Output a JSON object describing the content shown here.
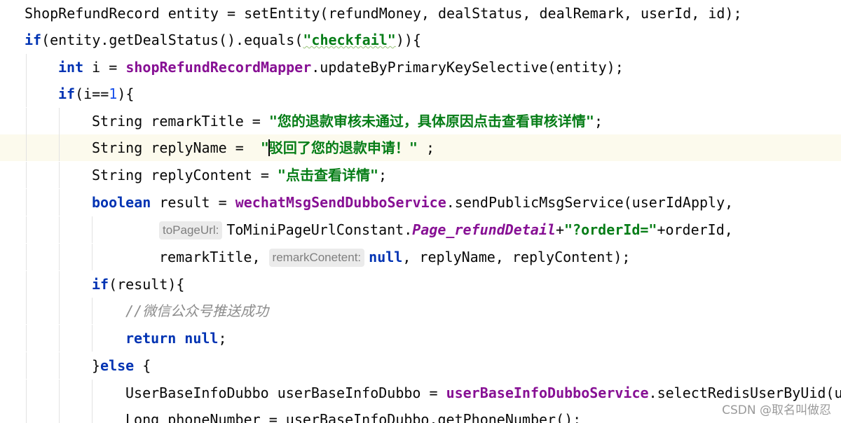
{
  "editor": {
    "lines": {
      "l1": {
        "code": "ShopRefundRecord entity = setEntity(refundMoney, dealStatus, dealRemark, userId, id);"
      },
      "l2": {
        "kw": "if",
        "pre": "(entity.getDealStatus().equals(",
        "str": "\"checkfail\"",
        "post": ")){"
      },
      "l3": {
        "kw": "int",
        "mid": " i = ",
        "fld": "shopRefundRecordMapper",
        "post": ".updateByPrimaryKeySelective(entity);"
      },
      "l4": {
        "kw": "if",
        "pre": "(i==",
        "num": "1",
        "post": "){"
      },
      "l5": {
        "pre": "String remarkTitle = ",
        "str": "\"您的退款审核未通过，具体原因点击查看审核详情\"",
        "post": ";"
      },
      "l6": {
        "pre": "String replyName =  ",
        "str_a": "\"",
        "str_b": "驳回了您的退款申请！\"",
        "post": " ;"
      },
      "l7": {
        "pre": "String replyContent = ",
        "str": "\"点击查看详情\"",
        "post": ";"
      },
      "l8": {
        "kw": "boolean",
        "mid": " result = ",
        "fld": "wechatMsgSendDubboService",
        "post": ".sendPublicMsgService(userIdApply,"
      },
      "l9": {
        "hint": "toPageUrl:",
        "pre": "ToMiniPageUrlConstant.",
        "ifld": "Page_refundDetail",
        "op": "+",
        "str": "\"?orderId=\"",
        "post": "+orderId,"
      },
      "l10": {
        "pre": "remarkTitle, ",
        "hint": "remarkConetent:",
        "kw": "null",
        "post": ", replyName, replyContent);"
      },
      "l11": {
        "kw": "if",
        "post": "(result){"
      },
      "l12": {
        "cmt": "//微信公众号推送成功"
      },
      "l13": {
        "kw_a": "return",
        "kw_b": "null",
        "post": ";"
      },
      "l14": {
        "pre": "}",
        "kw": "else",
        "post": " {"
      },
      "l15": {
        "pre": "UserBaseInfoDubbo userBaseInfoDubbo = ",
        "fld": "userBaseInfoDubboService",
        "post": ".selectRedisUserByUid(u"
      },
      "l16": {
        "code": "Long phoneNumber = userBaseInfoDubbo.getPhoneNumber();"
      }
    }
  },
  "watermark": "CSDN @取名叫做忍"
}
